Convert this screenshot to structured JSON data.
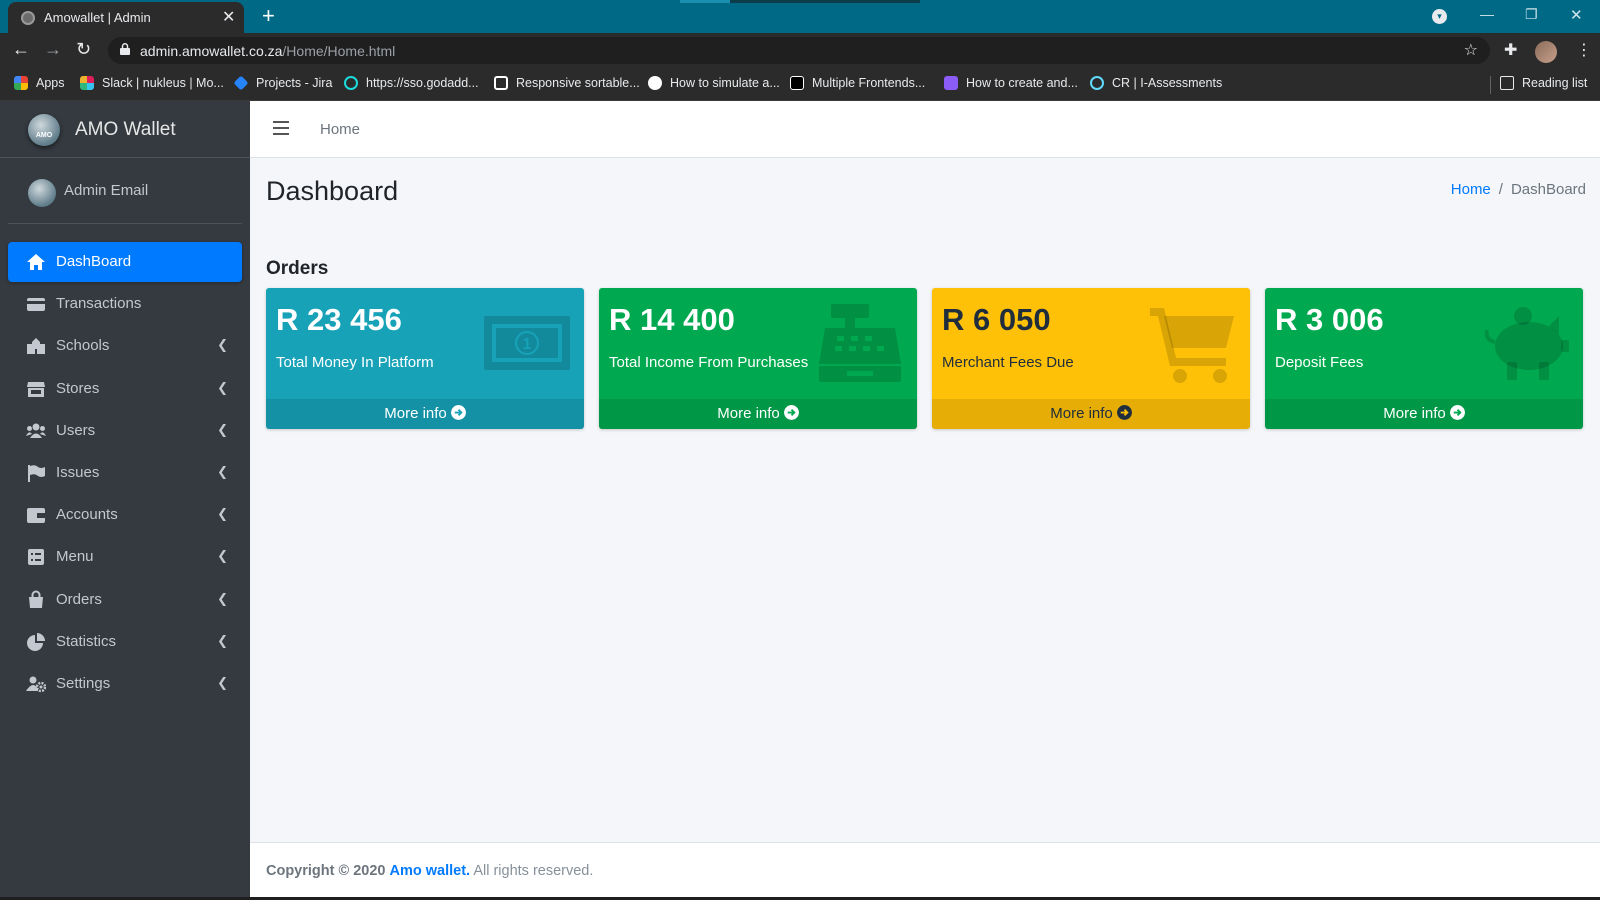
{
  "browser": {
    "tab_title": "Amowallet | Admin",
    "tab_close": "✕",
    "new_tab": "+",
    "url_host": "admin.amowallet.co.za",
    "url_path": "/Home/Home.html",
    "bookmarks": [
      {
        "label": "Apps",
        "color": "#ea4335"
      },
      {
        "label": "Slack | nukleus | Mo...",
        "color": "#e01e5a"
      },
      {
        "label": "Projects - Jira",
        "color": "#2684ff"
      },
      {
        "label": "https://sso.godadd...",
        "color": "#1bdbdb"
      },
      {
        "label": "Responsive sortable...",
        "color": "#ffffff"
      },
      {
        "label": "How to simulate a...",
        "color": "#ffffff"
      },
      {
        "label": "Multiple Frontends...",
        "color": "#ffffff"
      },
      {
        "label": "How to create and...",
        "color": "#8b5cf6"
      },
      {
        "label": "CR | I-Assessments",
        "color": "#61dafb"
      }
    ],
    "reading_list": "Reading list"
  },
  "sidebar": {
    "brand": "AMO Wallet",
    "brand_logo_text": "AMO",
    "user": "Admin Email",
    "items": [
      {
        "label": "DashBoard",
        "icon": "home-icon",
        "active": true,
        "chevron": false
      },
      {
        "label": "Transactions",
        "icon": "credit-card-icon",
        "active": false,
        "chevron": false
      },
      {
        "label": "Schools",
        "icon": "school-icon",
        "active": false,
        "chevron": true
      },
      {
        "label": "Stores",
        "icon": "store-icon",
        "active": false,
        "chevron": true
      },
      {
        "label": "Users",
        "icon": "users-icon",
        "active": false,
        "chevron": true
      },
      {
        "label": "Issues",
        "icon": "flag-icon",
        "active": false,
        "chevron": true
      },
      {
        "label": "Accounts",
        "icon": "wallet-icon",
        "active": false,
        "chevron": true
      },
      {
        "label": "Menu",
        "icon": "menu-list-icon",
        "active": false,
        "chevron": true
      },
      {
        "label": "Orders",
        "icon": "shopping-bag-icon",
        "active": false,
        "chevron": true
      },
      {
        "label": "Statistics",
        "icon": "pie-chart-icon",
        "active": false,
        "chevron": true
      },
      {
        "label": "Settings",
        "icon": "users-cog-icon",
        "active": false,
        "chevron": true
      }
    ]
  },
  "topnav": {
    "home": "Home"
  },
  "page": {
    "title": "Dashboard",
    "breadcrumb": {
      "home": "Home",
      "separator": "/",
      "current": "DashBoard"
    },
    "section": "Orders"
  },
  "cards": [
    {
      "value": "R 23 456",
      "label": "Total Money In Platform",
      "more": "More info",
      "bg": "#17a2b8",
      "icon": "money-bill-icon"
    },
    {
      "value": "R 14 400",
      "label": "Total Income From Purchases",
      "more": "More info",
      "bg": "#00a94f",
      "icon": "cash-register-icon"
    },
    {
      "value": "R 6 050",
      "label": "Merchant Fees Due",
      "more": "More info",
      "bg": "#ffc107",
      "icon": "shopping-cart-icon"
    },
    {
      "value": "R 3 006",
      "label": "Deposit Fees",
      "more": "More info",
      "bg": "#00a94f",
      "icon": "piggy-bank-icon"
    }
  ],
  "footer": {
    "copyright": "Copyright © 2020",
    "brand": "Amo wallet.",
    "rights": "All rights reserved."
  },
  "colors": {
    "accent": "#007bff",
    "sidebar": "#343a40",
    "chrome": "#006a86"
  }
}
